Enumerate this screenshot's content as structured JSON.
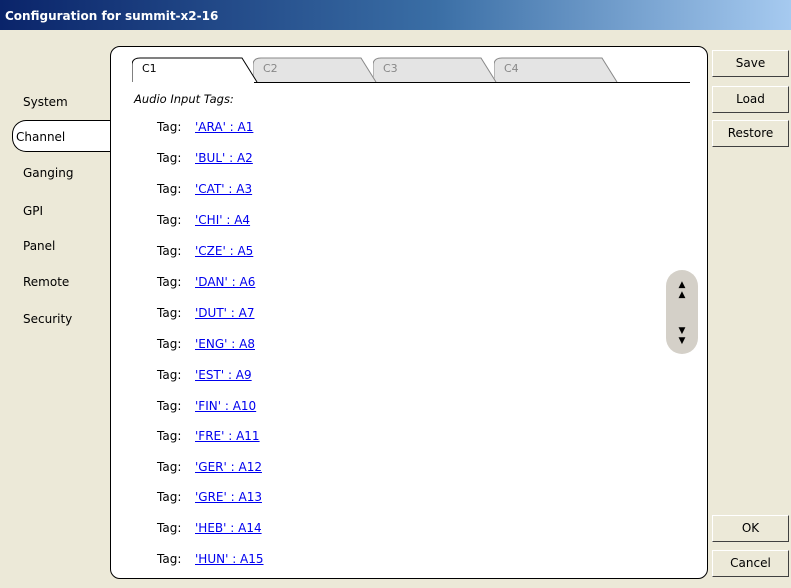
{
  "window": {
    "title": "Configuration for summit-x2-16"
  },
  "nav": {
    "items": [
      {
        "label": "System"
      },
      {
        "label": "Channel",
        "selected": true
      },
      {
        "label": "Ganging"
      },
      {
        "label": "GPI"
      },
      {
        "label": "Panel"
      },
      {
        "label": "Remote"
      },
      {
        "label": "Security"
      }
    ]
  },
  "tabs": [
    {
      "label": "C1",
      "active": true
    },
    {
      "label": "C2"
    },
    {
      "label": "C3"
    },
    {
      "label": "C4"
    }
  ],
  "content": {
    "section_title": "Audio Input Tags:",
    "tag_label": "Tag:",
    "tags": [
      "'ARA' : A1",
      "'BUL' : A2",
      "'CAT' : A3",
      "'CHI' : A4",
      "'CZE' : A5",
      "'DAN' : A6",
      "'DUT' : A7",
      "'ENG' : A8",
      "'EST' : A9",
      "'FIN' : A10",
      "'FRE' : A11",
      "'GER' : A12",
      "'GRE' : A13",
      "'HEB' : A14",
      "'HUN' : A15"
    ]
  },
  "scroll": {
    "up_icon": "chevron-double-up-icon",
    "down_icon": "chevron-double-down-icon"
  },
  "buttons": {
    "save": "Save",
    "load": "Load",
    "restore": "Restore",
    "ok": "OK",
    "cancel": "Cancel"
  }
}
